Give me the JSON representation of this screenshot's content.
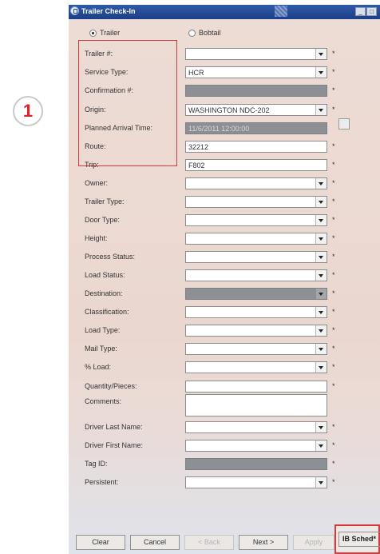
{
  "callout": {
    "number": "1"
  },
  "window": {
    "title": "Trailer Check-In",
    "controls": {
      "minimize": "_",
      "close": "□"
    }
  },
  "mode": {
    "options": [
      "Trailer",
      "Bobtail"
    ],
    "selected": "Trailer"
  },
  "fields": [
    {
      "label": "Trailer #:",
      "value": "",
      "kind": "dropdown",
      "required": "*"
    },
    {
      "label": "Service Type:",
      "value": "HCR",
      "kind": "dropdown",
      "required": "*"
    },
    {
      "label": "Confirmation #:",
      "value": "",
      "kind": "gray-text",
      "required": "*"
    },
    {
      "label": "Origin:",
      "value": "WASHINGTON NDC-202",
      "kind": "dropdown",
      "required": "*"
    },
    {
      "label": "Planned Arrival Time:",
      "value": "11/6/2011 12:00:00",
      "kind": "gray-text",
      "required": ""
    },
    {
      "label": "Route:",
      "value": "32212",
      "kind": "text",
      "required": "*"
    },
    {
      "label": "Trip:",
      "value": "F802",
      "kind": "text",
      "required": "*"
    },
    {
      "label": "Owner:",
      "value": "",
      "kind": "dropdown",
      "required": "*"
    },
    {
      "label": "Trailer Type:",
      "value": "",
      "kind": "dropdown",
      "required": "*"
    },
    {
      "label": "Door Type:",
      "value": "",
      "kind": "dropdown",
      "required": "*"
    },
    {
      "label": "Height:",
      "value": "",
      "kind": "dropdown",
      "required": "*"
    },
    {
      "label": "Process Status:",
      "value": "",
      "kind": "dropdown",
      "required": "*"
    },
    {
      "label": "Load Status:",
      "value": "",
      "kind": "dropdown",
      "required": "*"
    },
    {
      "label": "Destination:",
      "value": "",
      "kind": "gray-dropdown",
      "required": "*"
    },
    {
      "label": "Classification:",
      "value": "",
      "kind": "dropdown",
      "required": "*"
    },
    {
      "label": "Load Type:",
      "value": "",
      "kind": "dropdown",
      "required": "*"
    },
    {
      "label": "Mail Type:",
      "value": "",
      "kind": "dropdown",
      "required": "*"
    },
    {
      "label": "% Load:",
      "value": "",
      "kind": "dropdown",
      "required": "*"
    },
    {
      "label": "Quantity/Pieces:",
      "value": "",
      "kind": "text",
      "required": "*"
    },
    {
      "label": "Comments:",
      "value": "",
      "kind": "textarea",
      "required": ""
    },
    {
      "label": "Driver Last Name:",
      "value": "",
      "kind": "dropdown",
      "required": "*"
    },
    {
      "label": "Driver First Name:",
      "value": "",
      "kind": "dropdown",
      "required": "*"
    },
    {
      "label": "Tag ID:",
      "value": "",
      "kind": "gray-text",
      "required": "*"
    },
    {
      "label": "Persistent:",
      "value": "",
      "kind": "dropdown",
      "required": "*"
    }
  ],
  "buttons": {
    "clear": "Clear",
    "cancel": "Cancel",
    "back": "< Back",
    "next": "Next >",
    "apply": "Apply",
    "ib_sched": "IB Sched*"
  },
  "colors": {
    "titlebar": "#1c3f86",
    "highlight": "#d73a3a",
    "callout_number": "#d9242b"
  }
}
